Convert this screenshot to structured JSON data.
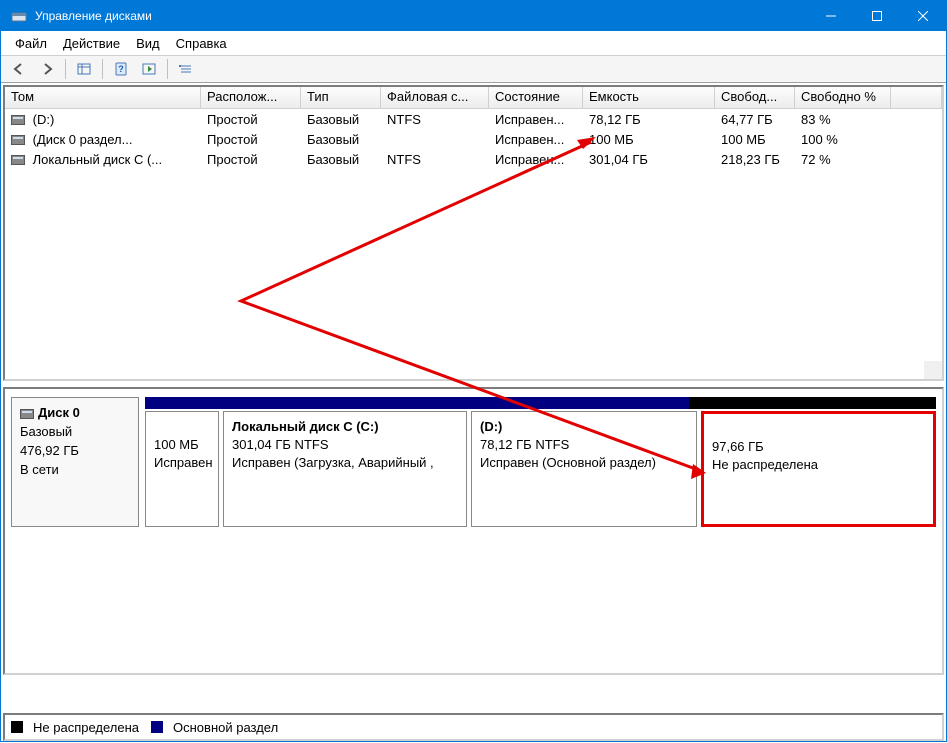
{
  "window": {
    "title": "Управление дисками"
  },
  "menu": {
    "file": "Файл",
    "action": "Действие",
    "view": "Вид",
    "help": "Справка"
  },
  "columns": {
    "volume": "Том",
    "layout": "Располож...",
    "type": "Тип",
    "fs": "Файловая с...",
    "state": "Состояние",
    "capacity": "Емкость",
    "free": "Свобод...",
    "free_pct": "Свободно %"
  },
  "volumes": [
    {
      "name": " (D:)",
      "layout": "Простой",
      "type": "Базовый",
      "fs": "NTFS",
      "state": "Исправен...",
      "cap": "78,12 ГБ",
      "free": "64,77 ГБ",
      "pct": "83 %"
    },
    {
      "name": " (Диск 0 раздел...",
      "layout": "Простой",
      "type": "Базовый",
      "fs": "",
      "state": "Исправен...",
      "cap": "100 МБ",
      "free": "100 МБ",
      "pct": "100 %"
    },
    {
      "name": " Локальный диск C (...",
      "layout": "Простой",
      "type": "Базовый",
      "fs": "NTFS",
      "state": "Исправен...",
      "cap": "301,04 ГБ",
      "free": "218,23 ГБ",
      "pct": "72 %"
    }
  ],
  "disk": {
    "name": "Диск 0",
    "type": "Базовый",
    "size": "476,92 ГБ",
    "status": "В сети",
    "partitions": [
      {
        "title": "",
        "line2": "100 МБ",
        "line3": "Исправен",
        "bold": false,
        "barClass": "primary",
        "flex": "0 0 74px",
        "highlight": false
      },
      {
        "title": "Локальный диск C  (C:)",
        "line2": "301,04 ГБ NTFS",
        "line3": "Исправен (Загрузка, Аварийный ,",
        "bold": true,
        "barClass": "primary",
        "flex": "0 0 244px",
        "highlight": false
      },
      {
        "title": "(D:)",
        "line2": "78,12 ГБ NTFS",
        "line3": "Исправен (Основной раздел)",
        "bold": true,
        "barClass": "primary",
        "flex": "0 0 226px",
        "highlight": false
      },
      {
        "title": "",
        "line2": "97,66 ГБ",
        "line3": "Не распределена",
        "bold": false,
        "barClass": "unalloc",
        "flex": "1",
        "highlight": true
      }
    ]
  },
  "legend": {
    "unallocated": "Не распределена",
    "primary": "Основной раздел"
  }
}
